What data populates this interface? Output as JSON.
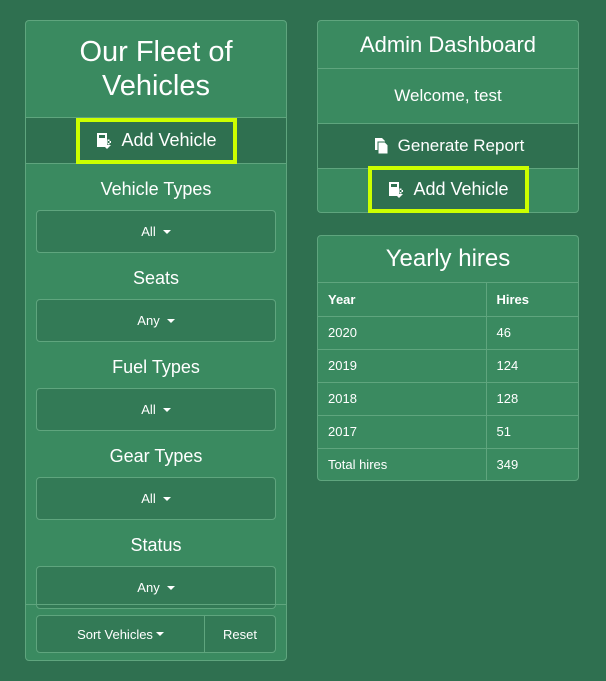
{
  "fleet_panel": {
    "title": "Our Fleet of Vehicles",
    "add_vehicle_label": "Add Vehicle",
    "filters": [
      {
        "label": "Vehicle Types",
        "value": "All"
      },
      {
        "label": "Seats",
        "value": "Any"
      },
      {
        "label": "Fuel Types",
        "value": "All"
      },
      {
        "label": "Gear Types",
        "value": "All"
      },
      {
        "label": "Status",
        "value": "Any"
      }
    ],
    "sort_label": "Sort Vehicles",
    "reset_label": "Reset"
  },
  "admin_panel": {
    "title": "Admin Dashboard",
    "welcome": "Welcome, test",
    "generate_report_label": "Generate Report",
    "add_vehicle_label": "Add Vehicle"
  },
  "hires_panel": {
    "title": "Yearly hires",
    "columns": [
      "Year",
      "Hires"
    ],
    "rows": [
      {
        "year": "2020",
        "hires": "46"
      },
      {
        "year": "2019",
        "hires": "124"
      },
      {
        "year": "2018",
        "hires": "128"
      },
      {
        "year": "2017",
        "hires": "51"
      },
      {
        "year": "Total hires",
        "hires": "349"
      }
    ]
  },
  "colors": {
    "background": "#2f7050",
    "panel": "#3a8a60",
    "highlight": "#ccff00"
  },
  "icons": [
    "add-vehicle-icon",
    "report-icon",
    "caret-down-icon"
  ]
}
